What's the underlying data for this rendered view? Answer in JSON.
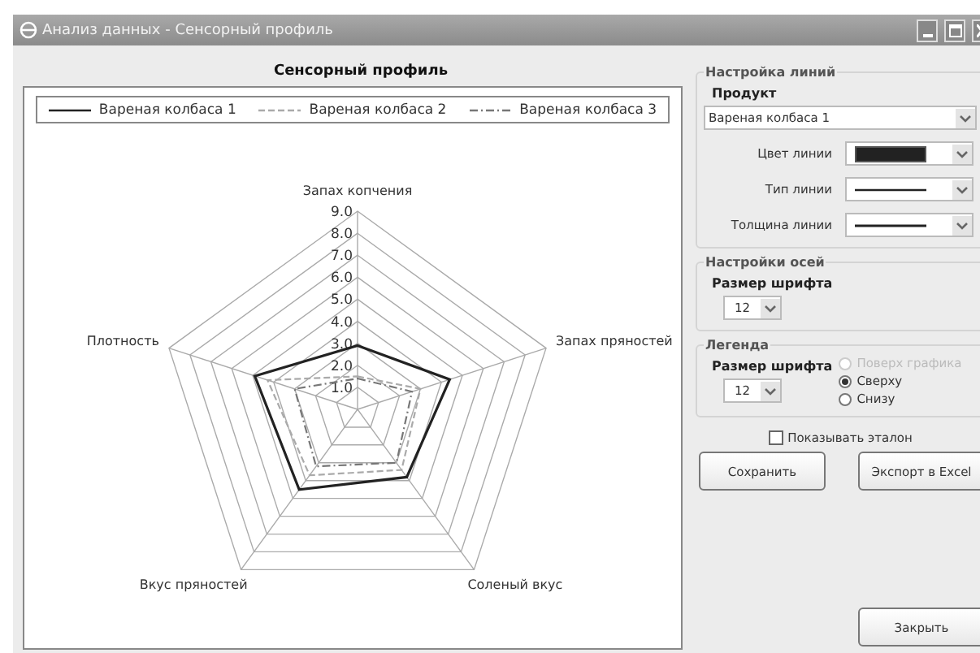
{
  "window": {
    "title": "Анализ данных - Сенсорный профиль"
  },
  "chart_title": "Сенсорный профиль",
  "radar": {
    "axes": [
      "Запах копчения",
      "Плотность",
      "Запах пряностей",
      "Вкус пряностей",
      "Соленый вкус"
    ],
    "series": [
      {
        "name": "Вареная колбаса 1",
        "color": "#222222",
        "kind": "solid"
      },
      {
        "name": "Вареная колбаса 2",
        "color": "#aaaaaa",
        "kind": "dashed"
      },
      {
        "name": "Вареная колбаса 3",
        "color": "#777777",
        "kind": "dashdot"
      }
    ],
    "tick_labels": [
      "9.0",
      "8.0",
      "7.0",
      "6.0",
      "5.0",
      "4.0",
      "3.0",
      "2.0",
      "1.0"
    ]
  },
  "line_settings": {
    "title": "Настройка линий",
    "product_label": "Продукт",
    "product_value": "Вареная колбаса 1",
    "color_label": "Цвет линии",
    "color": "#222222",
    "type_label": "Тип линии",
    "width_label": "Толщина линии"
  },
  "axis_settings": {
    "title": "Настройки осей",
    "font_label": "Размер шрифта",
    "font_size": "12"
  },
  "legend_settings": {
    "title": "Легенда",
    "font_label": "Размер шрифта",
    "font_size": "12",
    "positions": [
      {
        "label": "Поверх графика",
        "selected": false,
        "disabled": true
      },
      {
        "label": "Сверху",
        "selected": true,
        "disabled": false
      },
      {
        "label": "Снизу",
        "selected": false,
        "disabled": false
      }
    ]
  },
  "show_reference": {
    "label": "Показывать эталон",
    "checked": false
  },
  "buttons": [
    {
      "label": "Сохранить"
    },
    {
      "label": "Экспорт в Excel"
    }
  ],
  "close_button": {
    "label": "Закрыть"
  }
}
